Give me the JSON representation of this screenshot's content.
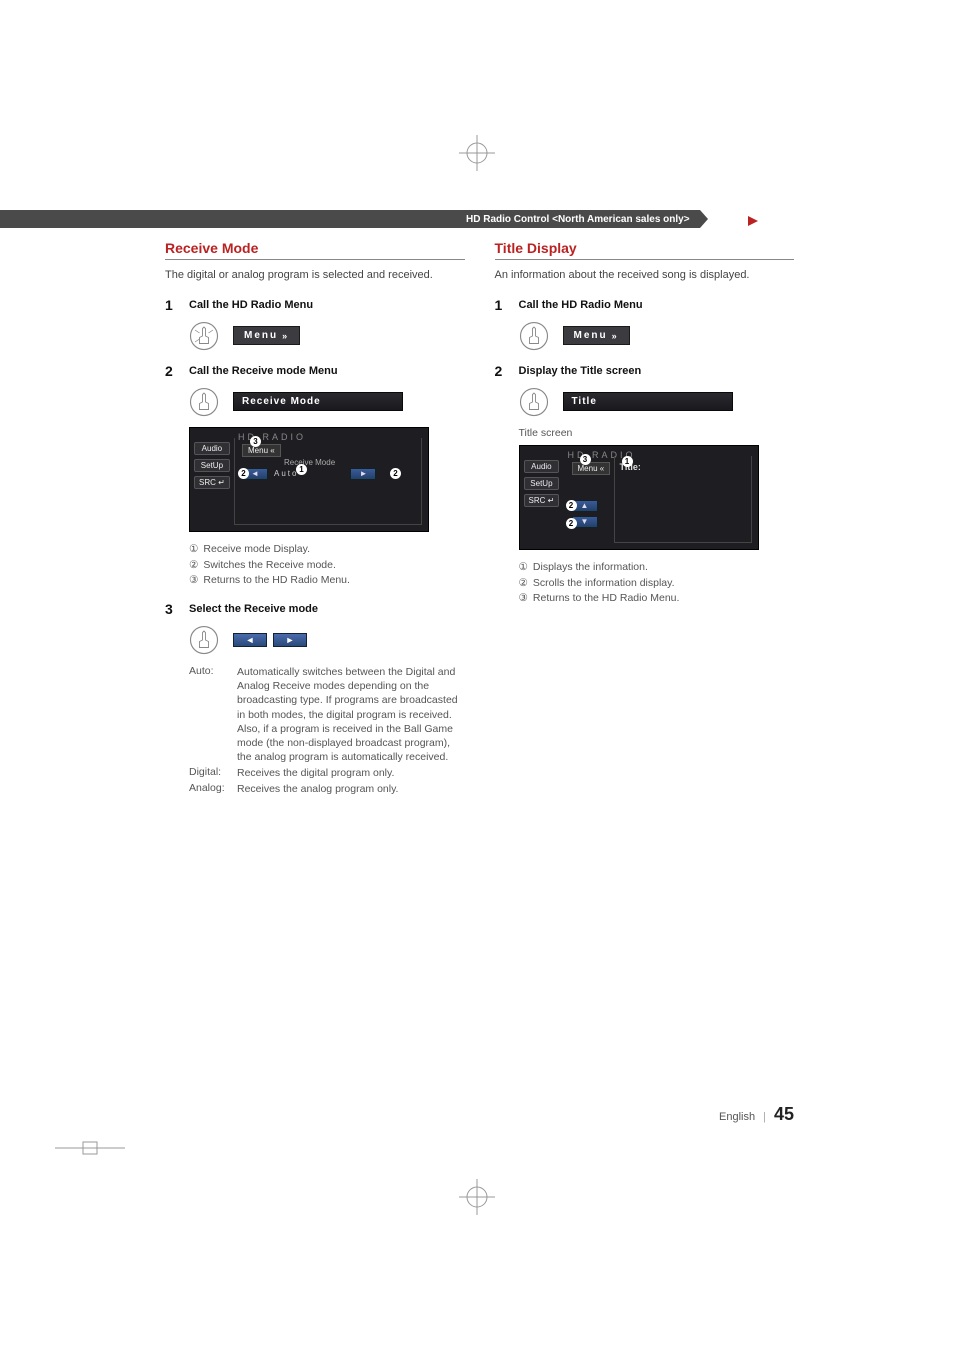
{
  "header": {
    "label": "HD Radio Control <North American sales only>"
  },
  "left": {
    "heading": "Receive Mode",
    "intro": "The digital or analog program is selected and received.",
    "steps": {
      "s1": {
        "num": "1",
        "title": "Call the HD Radio Menu",
        "menu_btn": "Menu"
      },
      "s2": {
        "num": "2",
        "title": "Call the Receive mode Menu",
        "bar_btn": "Receive Mode"
      },
      "s3": {
        "num": "3",
        "title": "Select the Receive mode"
      }
    },
    "screen": {
      "hd": "HD RADIO",
      "side": {
        "audio": "Audio",
        "setup": "SetUp",
        "src": "SRC"
      },
      "menu_back": "Menu",
      "row_label": "Receive Mode",
      "value": "Auto"
    },
    "legend": {
      "l1": "Receive mode Display.",
      "l2": "Switches the Receive mode.",
      "l3": "Returns to the HD Radio Menu."
    },
    "defs": {
      "auto_label": "Auto:",
      "auto_val": "Automatically switches between the Digital and Analog Receive modes depending on the broadcasting type. If programs are broadcasted in both modes, the digital program is received. Also, if a program is received in the Ball Game mode (the non-displayed broadcast program), the analog program is automatically received.",
      "digital_label": "Digital:",
      "digital_val": "Receives the digital program only.",
      "analog_label": "Analog:",
      "analog_val": "Receives the analog program only."
    }
  },
  "right": {
    "heading": "Title Display",
    "intro": "An information about the received song is displayed.",
    "steps": {
      "s1": {
        "num": "1",
        "title": "Call the HD Radio Menu",
        "menu_btn": "Menu"
      },
      "s2": {
        "num": "2",
        "title": "Display the Title screen",
        "bar_btn": "Title"
      }
    },
    "title_caption": "Title screen",
    "screen": {
      "hd": "HD RADIO",
      "side": {
        "audio": "Audio",
        "setup": "SetUp",
        "src": "SRC"
      },
      "menu_back": "Menu",
      "title_label": "Title:"
    },
    "legend": {
      "l1": "Displays the information.",
      "l2": "Scrolls the information display.",
      "l3": "Returns to the HD Radio Menu."
    }
  },
  "footer": {
    "lang": "English",
    "page": "45"
  },
  "glyphs": {
    "c1": "①",
    "c2": "②",
    "c3": "③"
  }
}
